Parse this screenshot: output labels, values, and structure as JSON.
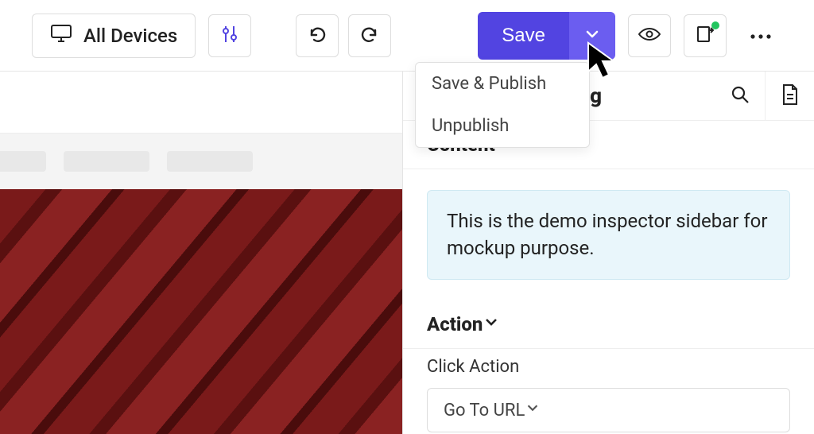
{
  "toolbar": {
    "device_label": "All Devices",
    "save_label": "Save",
    "dropdown": {
      "publish": "Save & Publish",
      "unpublish": "Unpublish"
    }
  },
  "sidebar": {
    "title_suffix": "ng",
    "sections": {
      "content": "Content",
      "action": "Action"
    },
    "note": "This is the demo inspector sidebar for mockup purpose.",
    "click_action_label": "Click Action",
    "click_action_value": "Go To URL"
  }
}
